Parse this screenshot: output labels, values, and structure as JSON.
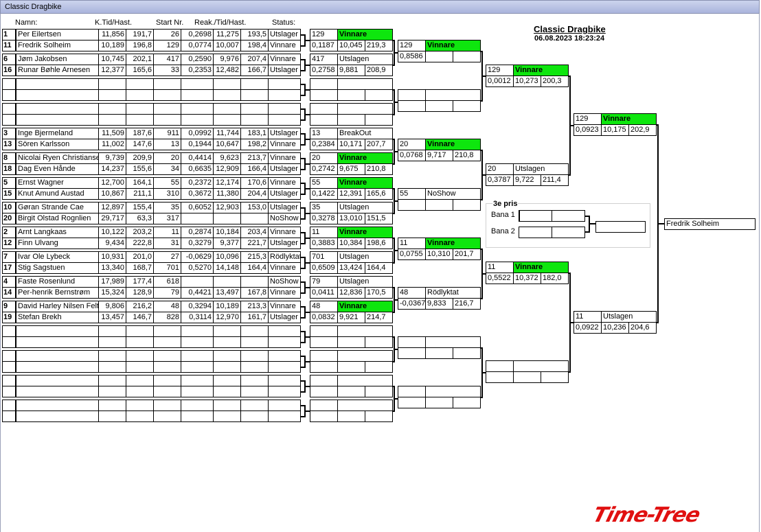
{
  "window": {
    "title": "Classic Dragbike"
  },
  "headers": {
    "name": "Namn:",
    "kt": "K.Tid/Hast.",
    "start": "Start Nr.",
    "reak": "Reak./Tid/Hast.",
    "status": "Status:"
  },
  "event": {
    "title": "Classic Dragbike",
    "datetime": "06.08.2023 18:23:24"
  },
  "third_prize": {
    "title": "3e pris",
    "lane1": "Bana 1",
    "lane2": "Bana 2"
  },
  "winner": {
    "name": "Fredrik Solheim"
  },
  "logo": {
    "text": "Time-Tree"
  },
  "colors": {
    "winner_green": "#0ee60e",
    "logo_red": "#e01010"
  },
  "entries": [
    {
      "pos": "1",
      "name": "Per  Eilertsen",
      "kt": "11,856",
      "hast": "191,7",
      "start": "26",
      "reak": "0,2698",
      "tid": "11,275",
      "sp": "193,5",
      "status": "Utslager"
    },
    {
      "pos": "11",
      "name": "Fredrik Solheim",
      "kt": "10,189",
      "hast": "196,8",
      "start": "129",
      "reak": "0,0774",
      "tid": "10,007",
      "sp": "198,4",
      "status": "Vinnare"
    },
    {
      "pos": "6",
      "name": "Jøm Jakobsen",
      "kt": "10,745",
      "hast": "202,1",
      "start": "417",
      "reak": "0,2590",
      "tid": "9,976",
      "sp": "207,4",
      "status": "Vinnare"
    },
    {
      "pos": "16",
      "name": "Runar Bøhle Arnesen",
      "kt": "12,377",
      "hast": "165,6",
      "start": "33",
      "reak": "0,2353",
      "tid": "12,482",
      "sp": "166,7",
      "status": "Utslager"
    },
    {
      "pos": "",
      "name": "",
      "kt": "",
      "hast": "",
      "start": "",
      "reak": "",
      "tid": "",
      "sp": "",
      "status": ""
    },
    {
      "pos": "",
      "name": "",
      "kt": "",
      "hast": "",
      "start": "",
      "reak": "",
      "tid": "",
      "sp": "",
      "status": ""
    },
    {
      "pos": "",
      "name": "",
      "kt": "",
      "hast": "",
      "start": "",
      "reak": "",
      "tid": "",
      "sp": "",
      "status": ""
    },
    {
      "pos": "",
      "name": "",
      "kt": "",
      "hast": "",
      "start": "",
      "reak": "",
      "tid": "",
      "sp": "",
      "status": ""
    },
    {
      "pos": "3",
      "name": "Inge Bjermeland",
      "kt": "11,509",
      "hast": "187,6",
      "start": "911",
      "reak": "0,0992",
      "tid": "11,744",
      "sp": "183,1",
      "status": "Utslager"
    },
    {
      "pos": "13",
      "name": "Sören Karlsson",
      "kt": "11,002",
      "hast": "147,6",
      "start": "13",
      "reak": "0,1944",
      "tid": "10,647",
      "sp": "198,2",
      "status": "Vinnare"
    },
    {
      "pos": "8",
      "name": "Nicolai Ryen Christianse",
      "kt": "9,739",
      "hast": "209,9",
      "start": "20",
      "reak": "0,4414",
      "tid": "9,623",
      "sp": "213,7",
      "status": "Vinnare"
    },
    {
      "pos": "18",
      "name": "Dag Even Hånde",
      "kt": "14,237",
      "hast": "155,6",
      "start": "34",
      "reak": "0,6635",
      "tid": "12,909",
      "sp": "166,4",
      "status": "Utslager"
    },
    {
      "pos": "5",
      "name": "Ernst Wagner",
      "kt": "12,700",
      "hast": "164,1",
      "start": "55",
      "reak": "0,2372",
      "tid": "12,174",
      "sp": "170,6",
      "status": "Vinnare"
    },
    {
      "pos": "15",
      "name": "Knut Amund Austad",
      "kt": "10,867",
      "hast": "211,1",
      "start": "310",
      "reak": "0,3672",
      "tid": "11,380",
      "sp": "204,4",
      "status": "Utslager"
    },
    {
      "pos": "10",
      "name": "Gøran Strande  Cae",
      "kt": "12,897",
      "hast": "155,4",
      "start": "35",
      "reak": "0,6052",
      "tid": "12,903",
      "sp": "153,0",
      "status": "Utslager"
    },
    {
      "pos": "20",
      "name": "Birgit Olstad Rognlien",
      "kt": "29,717",
      "hast": "63,3",
      "start": "317",
      "reak": "",
      "tid": "",
      "sp": "",
      "status": "NoShow"
    },
    {
      "pos": "2",
      "name": "Arnt Langkaas",
      "kt": "10,122",
      "hast": "203,2",
      "start": "11",
      "reak": "0,2874",
      "tid": "10,184",
      "sp": "203,4",
      "status": "Vinnare"
    },
    {
      "pos": "12",
      "name": "Finn Ulvang",
      "kt": "9,434",
      "hast": "222,8",
      "start": "31",
      "reak": "0,3279",
      "tid": "9,377",
      "sp": "221,7",
      "status": "Utslager"
    },
    {
      "pos": "7",
      "name": "Ivar Ole Lybeck",
      "kt": "10,931",
      "hast": "201,0",
      "start": "27",
      "reak": "-0,0629",
      "tid": "10,096",
      "sp": "215,3",
      "status": "Rödlyktat"
    },
    {
      "pos": "17",
      "name": "Stig Sagstuen",
      "kt": "13,340",
      "hast": "168,7",
      "start": "701",
      "reak": "0,5270",
      "tid": "14,148",
      "sp": "164,4",
      "status": "Vinnare"
    },
    {
      "pos": "4",
      "name": "Faste Rosenlund",
      "kt": "17,989",
      "hast": "177,4",
      "start": "618",
      "reak": "",
      "tid": "",
      "sp": "",
      "status": "NoShow"
    },
    {
      "pos": "14",
      "name": "Per-henrik Bernstrøm",
      "kt": "15,324",
      "hast": "128,9",
      "start": "79",
      "reak": "0,4421",
      "tid": "13,497",
      "sp": "167,8",
      "status": "Vinnare"
    },
    {
      "pos": "9",
      "name": "David Harley Nilsen Felt",
      "kt": "9,806",
      "hast": "216,2",
      "start": "48",
      "reak": "0,3294",
      "tid": "10,189",
      "sp": "213,3",
      "status": "Vinnare"
    },
    {
      "pos": "19",
      "name": "Stefan Brekh",
      "kt": "13,457",
      "hast": "146,7",
      "start": "828",
      "reak": "0,3114",
      "tid": "12,970",
      "sp": "161,7",
      "status": "Utslager"
    },
    {
      "pos": "",
      "name": "",
      "kt": "",
      "hast": "",
      "start": "",
      "reak": "",
      "tid": "",
      "sp": "",
      "status": ""
    },
    {
      "pos": "",
      "name": "",
      "kt": "",
      "hast": "",
      "start": "",
      "reak": "",
      "tid": "",
      "sp": "",
      "status": ""
    },
    {
      "pos": "",
      "name": "",
      "kt": "",
      "hast": "",
      "start": "",
      "reak": "",
      "tid": "",
      "sp": "",
      "status": ""
    },
    {
      "pos": "",
      "name": "",
      "kt": "",
      "hast": "",
      "start": "",
      "reak": "",
      "tid": "",
      "sp": "",
      "status": ""
    },
    {
      "pos": "",
      "name": "",
      "kt": "",
      "hast": "",
      "start": "",
      "reak": "",
      "tid": "",
      "sp": "",
      "status": ""
    },
    {
      "pos": "",
      "name": "",
      "kt": "",
      "hast": "",
      "start": "",
      "reak": "",
      "tid": "",
      "sp": "",
      "status": ""
    },
    {
      "pos": "",
      "name": "",
      "kt": "",
      "hast": "",
      "start": "",
      "reak": "",
      "tid": "",
      "sp": "",
      "status": ""
    },
    {
      "pos": "",
      "name": "",
      "kt": "",
      "hast": "",
      "start": "",
      "reak": "",
      "tid": "",
      "sp": "",
      "status": ""
    }
  ],
  "round1": [
    {
      "nr": "129",
      "res": "Vinnare",
      "win": true,
      "reak": "0,1187",
      "tid": "10,045",
      "sp": "219,3"
    },
    {
      "nr": "417",
      "res": "Utslagen",
      "win": false,
      "reak": "0,2758",
      "tid": "9,881",
      "sp": "208,9"
    },
    {
      "nr": "",
      "res": "",
      "win": false,
      "reak": "",
      "tid": "",
      "sp": ""
    },
    {
      "nr": "",
      "res": "",
      "win": false,
      "reak": "",
      "tid": "",
      "sp": ""
    },
    {
      "nr": "13",
      "res": "BreakOut",
      "win": false,
      "reak": "0,2384",
      "tid": "10,171",
      "sp": "207,7"
    },
    {
      "nr": "20",
      "res": "Vinnare",
      "win": true,
      "reak": "0,2742",
      "tid": "9,675",
      "sp": "210,8"
    },
    {
      "nr": "55",
      "res": "Vinnare",
      "win": true,
      "reak": "0,1422",
      "tid": "12,391",
      "sp": "165,6"
    },
    {
      "nr": "35",
      "res": "Utslagen",
      "win": false,
      "reak": "0,3278",
      "tid": "13,010",
      "sp": "151,5"
    },
    {
      "nr": "11",
      "res": "Vinnare",
      "win": true,
      "reak": "0,3883",
      "tid": "10,384",
      "sp": "198,6"
    },
    {
      "nr": "701",
      "res": "Utslagen",
      "win": false,
      "reak": "0,6509",
      "tid": "13,424",
      "sp": "164,4"
    },
    {
      "nr": "79",
      "res": "Utslagen",
      "win": false,
      "reak": "0,0411",
      "tid": "12,836",
      "sp": "170,5"
    },
    {
      "nr": "48",
      "res": "Vinnare",
      "win": true,
      "reak": "0,0832",
      "tid": "9,921",
      "sp": "214,7"
    },
    {
      "nr": "",
      "res": "",
      "win": false,
      "reak": "",
      "tid": "",
      "sp": ""
    },
    {
      "nr": "",
      "res": "",
      "win": false,
      "reak": "",
      "tid": "",
      "sp": ""
    },
    {
      "nr": "",
      "res": "",
      "win": false,
      "reak": "",
      "tid": "",
      "sp": ""
    },
    {
      "nr": "",
      "res": "",
      "win": false,
      "reak": "",
      "tid": "",
      "sp": ""
    }
  ],
  "round2": [
    {
      "nr": "129",
      "res": "Vinnare",
      "win": true,
      "reak": "0,8586",
      "tid": "",
      "sp": ""
    },
    {
      "nr": "",
      "res": "",
      "win": false,
      "reak": "",
      "tid": "",
      "sp": ""
    },
    {
      "nr": "20",
      "res": "Vinnare",
      "win": true,
      "reak": "0,0768",
      "tid": "9,717",
      "sp": "210,8"
    },
    {
      "nr": "55",
      "res": "NoShow",
      "win": false,
      "reak": "",
      "tid": "",
      "sp": ""
    },
    {
      "nr": "11",
      "res": "Vinnare",
      "win": true,
      "reak": "0,0755",
      "tid": "10,310",
      "sp": "201,7"
    },
    {
      "nr": "48",
      "res": "Rödlyktat",
      "win": false,
      "reak": "-0,0367",
      "tid": "9,833",
      "sp": "216,7"
    },
    {
      "nr": "",
      "res": "",
      "win": false,
      "reak": "",
      "tid": "",
      "sp": ""
    },
    {
      "nr": "",
      "res": "",
      "win": false,
      "reak": "",
      "tid": "",
      "sp": ""
    }
  ],
  "round3": [
    {
      "nr": "129",
      "res": "Vinnare",
      "win": true,
      "reak": "0,0012",
      "tid": "10,273",
      "sp": "200,3"
    },
    {
      "nr": "20",
      "res": "Utslagen",
      "win": false,
      "reak": "0,3787",
      "tid": "9,722",
      "sp": "211,4"
    },
    {
      "nr": "11",
      "res": "Vinnare",
      "win": true,
      "reak": "0,5522",
      "tid": "10,372",
      "sp": "182,0"
    },
    {
      "nr": "",
      "res": "",
      "win": false,
      "reak": "",
      "tid": "",
      "sp": ""
    }
  ],
  "round4": [
    {
      "nr": "129",
      "res": "Vinnare",
      "win": true,
      "reak": "0,0923",
      "tid": "10,175",
      "sp": "202,9"
    },
    {
      "nr": "11",
      "res": "Utslagen",
      "win": false,
      "reak": "0,0922",
      "tid": "10,236",
      "sp": "204,6"
    }
  ]
}
